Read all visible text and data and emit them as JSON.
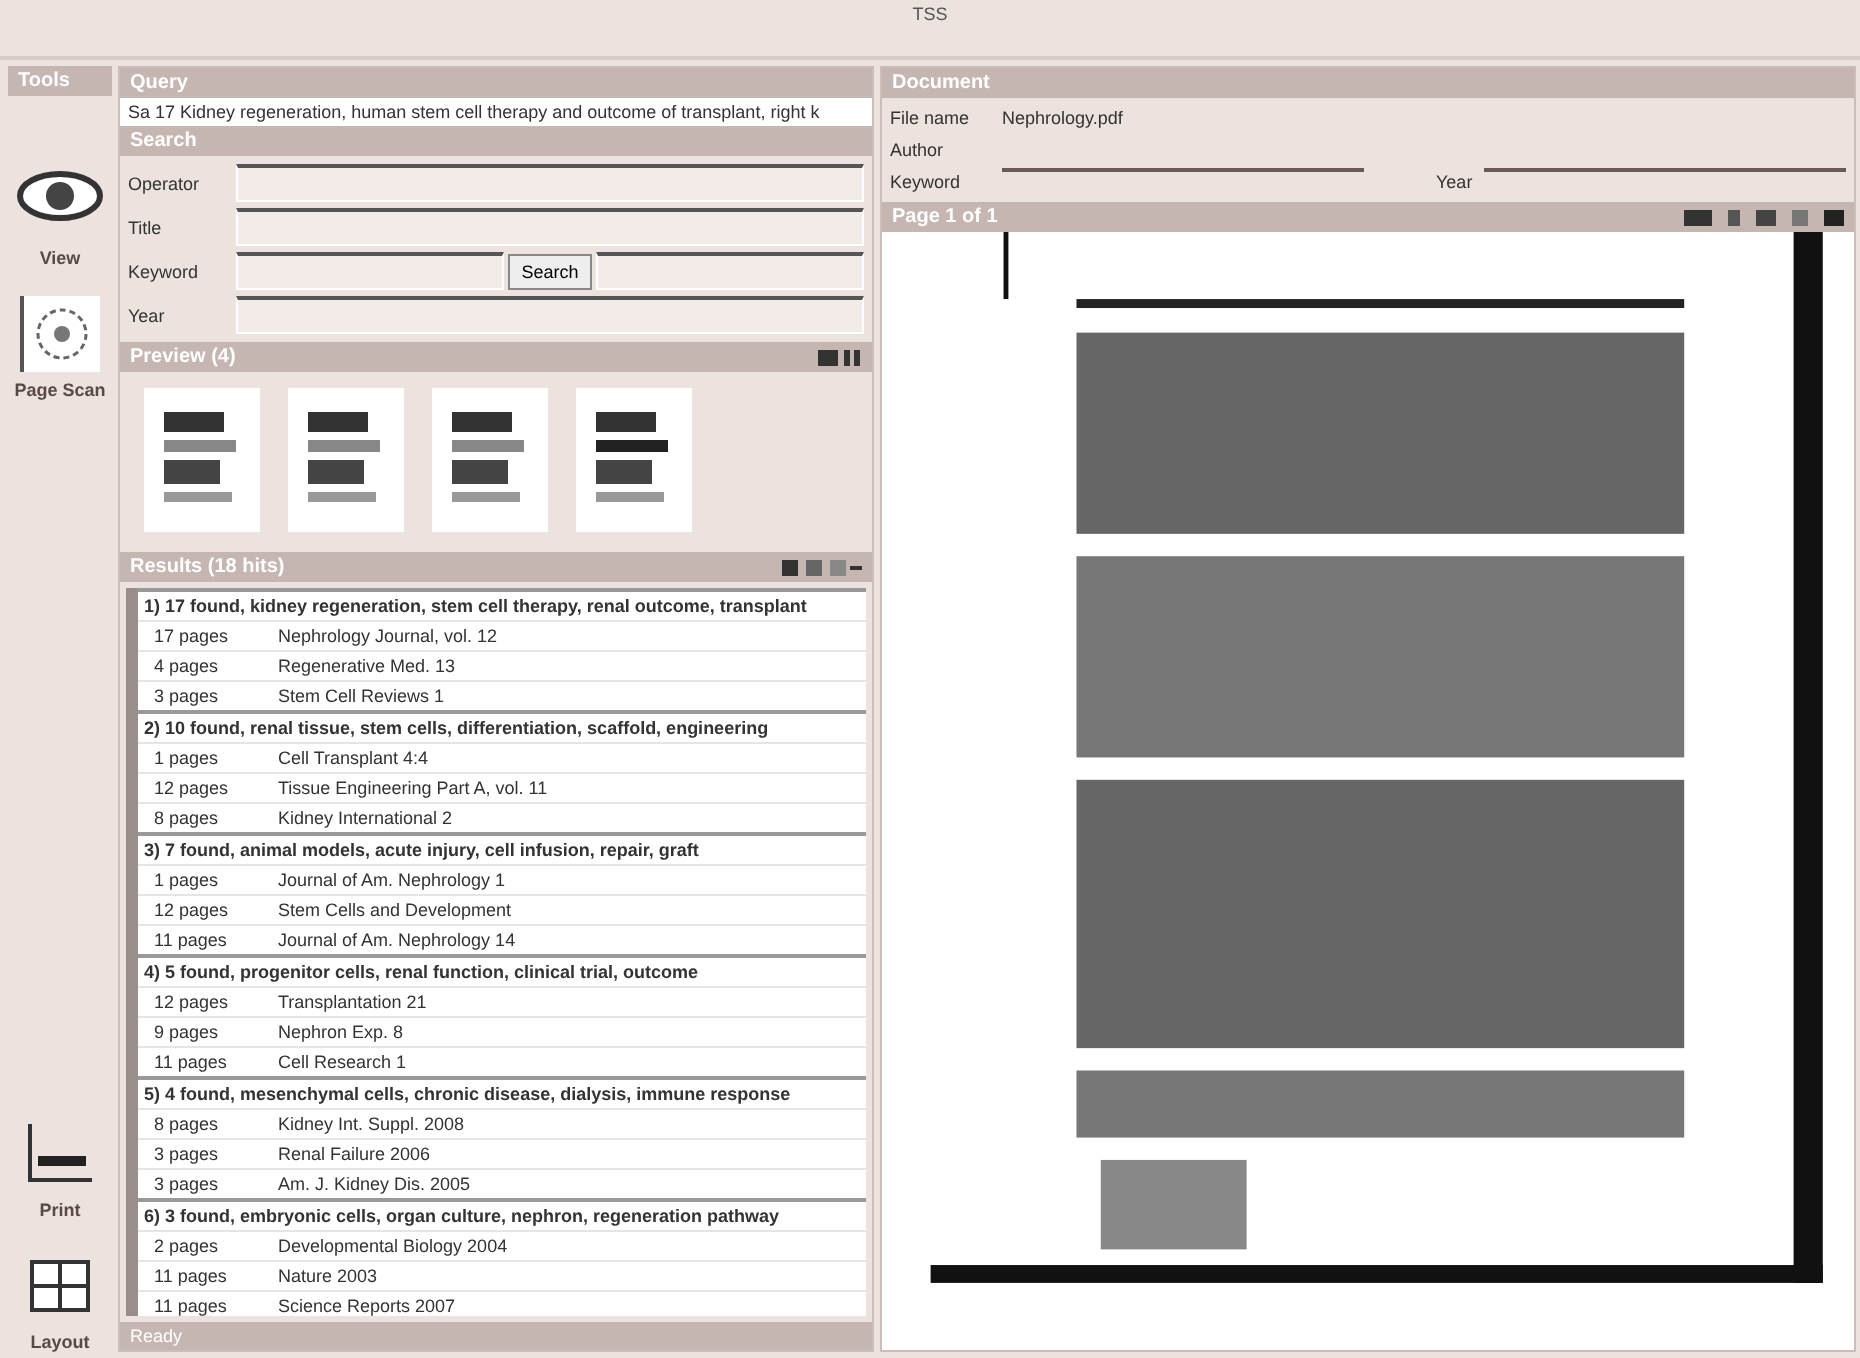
{
  "window": {
    "title": "TSS"
  },
  "sidebar": {
    "header": "Tools",
    "items": [
      {
        "kind": "eye",
        "label": "View",
        "selected": false
      },
      {
        "kind": "disc",
        "label": "Page Scan",
        "selected": true
      },
      {
        "kind": "chart",
        "label": "Print",
        "selected": false
      },
      {
        "kind": "grid",
        "label": "Layout",
        "selected": false
      }
    ]
  },
  "query": {
    "header": "Query",
    "text": "Sa 17 Kidney regeneration, human stem cell therapy and outcome of transplant, right k"
  },
  "search": {
    "header": "Search",
    "fields": [
      {
        "label": "Operator"
      },
      {
        "label": "Title"
      },
      {
        "label": "Keyword",
        "button": "Search"
      },
      {
        "label": "Year"
      }
    ]
  },
  "thumbnails": {
    "header": "Preview (4)"
  },
  "results": {
    "header": "Results (18 hits)",
    "groups": [
      {
        "title": "1) 17 found, kidney regeneration, stem cell therapy, renal outcome, transplant",
        "rows": [
          {
            "pages": "17 pages",
            "text": "Nephrology Journal, vol. 12"
          },
          {
            "pages": "4 pages",
            "text": "Regenerative Med. 13"
          },
          {
            "pages": "3 pages",
            "text": "Stem Cell Reviews 1"
          }
        ]
      },
      {
        "title": "2) 10 found, renal tissue, stem cells, differentiation, scaffold, engineering",
        "rows": [
          {
            "pages": "1 pages",
            "text": "Cell Transplant 4:4"
          },
          {
            "pages": "12 pages",
            "text": "Tissue Engineering Part A, vol. 11"
          },
          {
            "pages": "8 pages",
            "text": "Kidney International 2"
          }
        ]
      },
      {
        "title": "3) 7 found, animal models, acute injury, cell infusion, repair, graft",
        "rows": [
          {
            "pages": "1 pages",
            "text": "Journal of Am. Nephrology 1"
          },
          {
            "pages": "12 pages",
            "text": "Stem Cells and Development"
          },
          {
            "pages": "11 pages",
            "text": "Journal of Am. Nephrology 14"
          }
        ]
      },
      {
        "title": "4) 5 found, progenitor cells, renal function, clinical trial, outcome",
        "rows": [
          {
            "pages": "12 pages",
            "text": "Transplantation 21"
          },
          {
            "pages": "9 pages",
            "text": "Nephron Exp. 8"
          },
          {
            "pages": "11 pages",
            "text": "Cell Research 1"
          }
        ]
      },
      {
        "title": "5) 4 found, mesenchymal cells, chronic disease, dialysis, immune response",
        "rows": [
          {
            "pages": "8 pages",
            "text": "Kidney Int. Suppl. 2008"
          },
          {
            "pages": "3 pages",
            "text": "Renal Failure 2006"
          },
          {
            "pages": "3 pages",
            "text": "Am. J. Kidney Dis. 2005"
          }
        ]
      },
      {
        "title": "6) 3 found, embryonic cells, organ culture, nephron, regeneration pathway",
        "rows": [
          {
            "pages": "2 pages",
            "text": "Developmental Biology 2004"
          },
          {
            "pages": "11 pages",
            "text": "Nature 2003"
          },
          {
            "pages": "11 pages",
            "text": "Science Reports 2007"
          }
        ]
      }
    ]
  },
  "status": "Ready",
  "document": {
    "header": "Document",
    "fields": [
      {
        "label": "File name",
        "value": "Nephrology.pdf"
      },
      {
        "label": "Author"
      }
    ],
    "keyword_label": "Keyword",
    "year_label": "Year",
    "viewer_header": "Page 1 of 1"
  }
}
